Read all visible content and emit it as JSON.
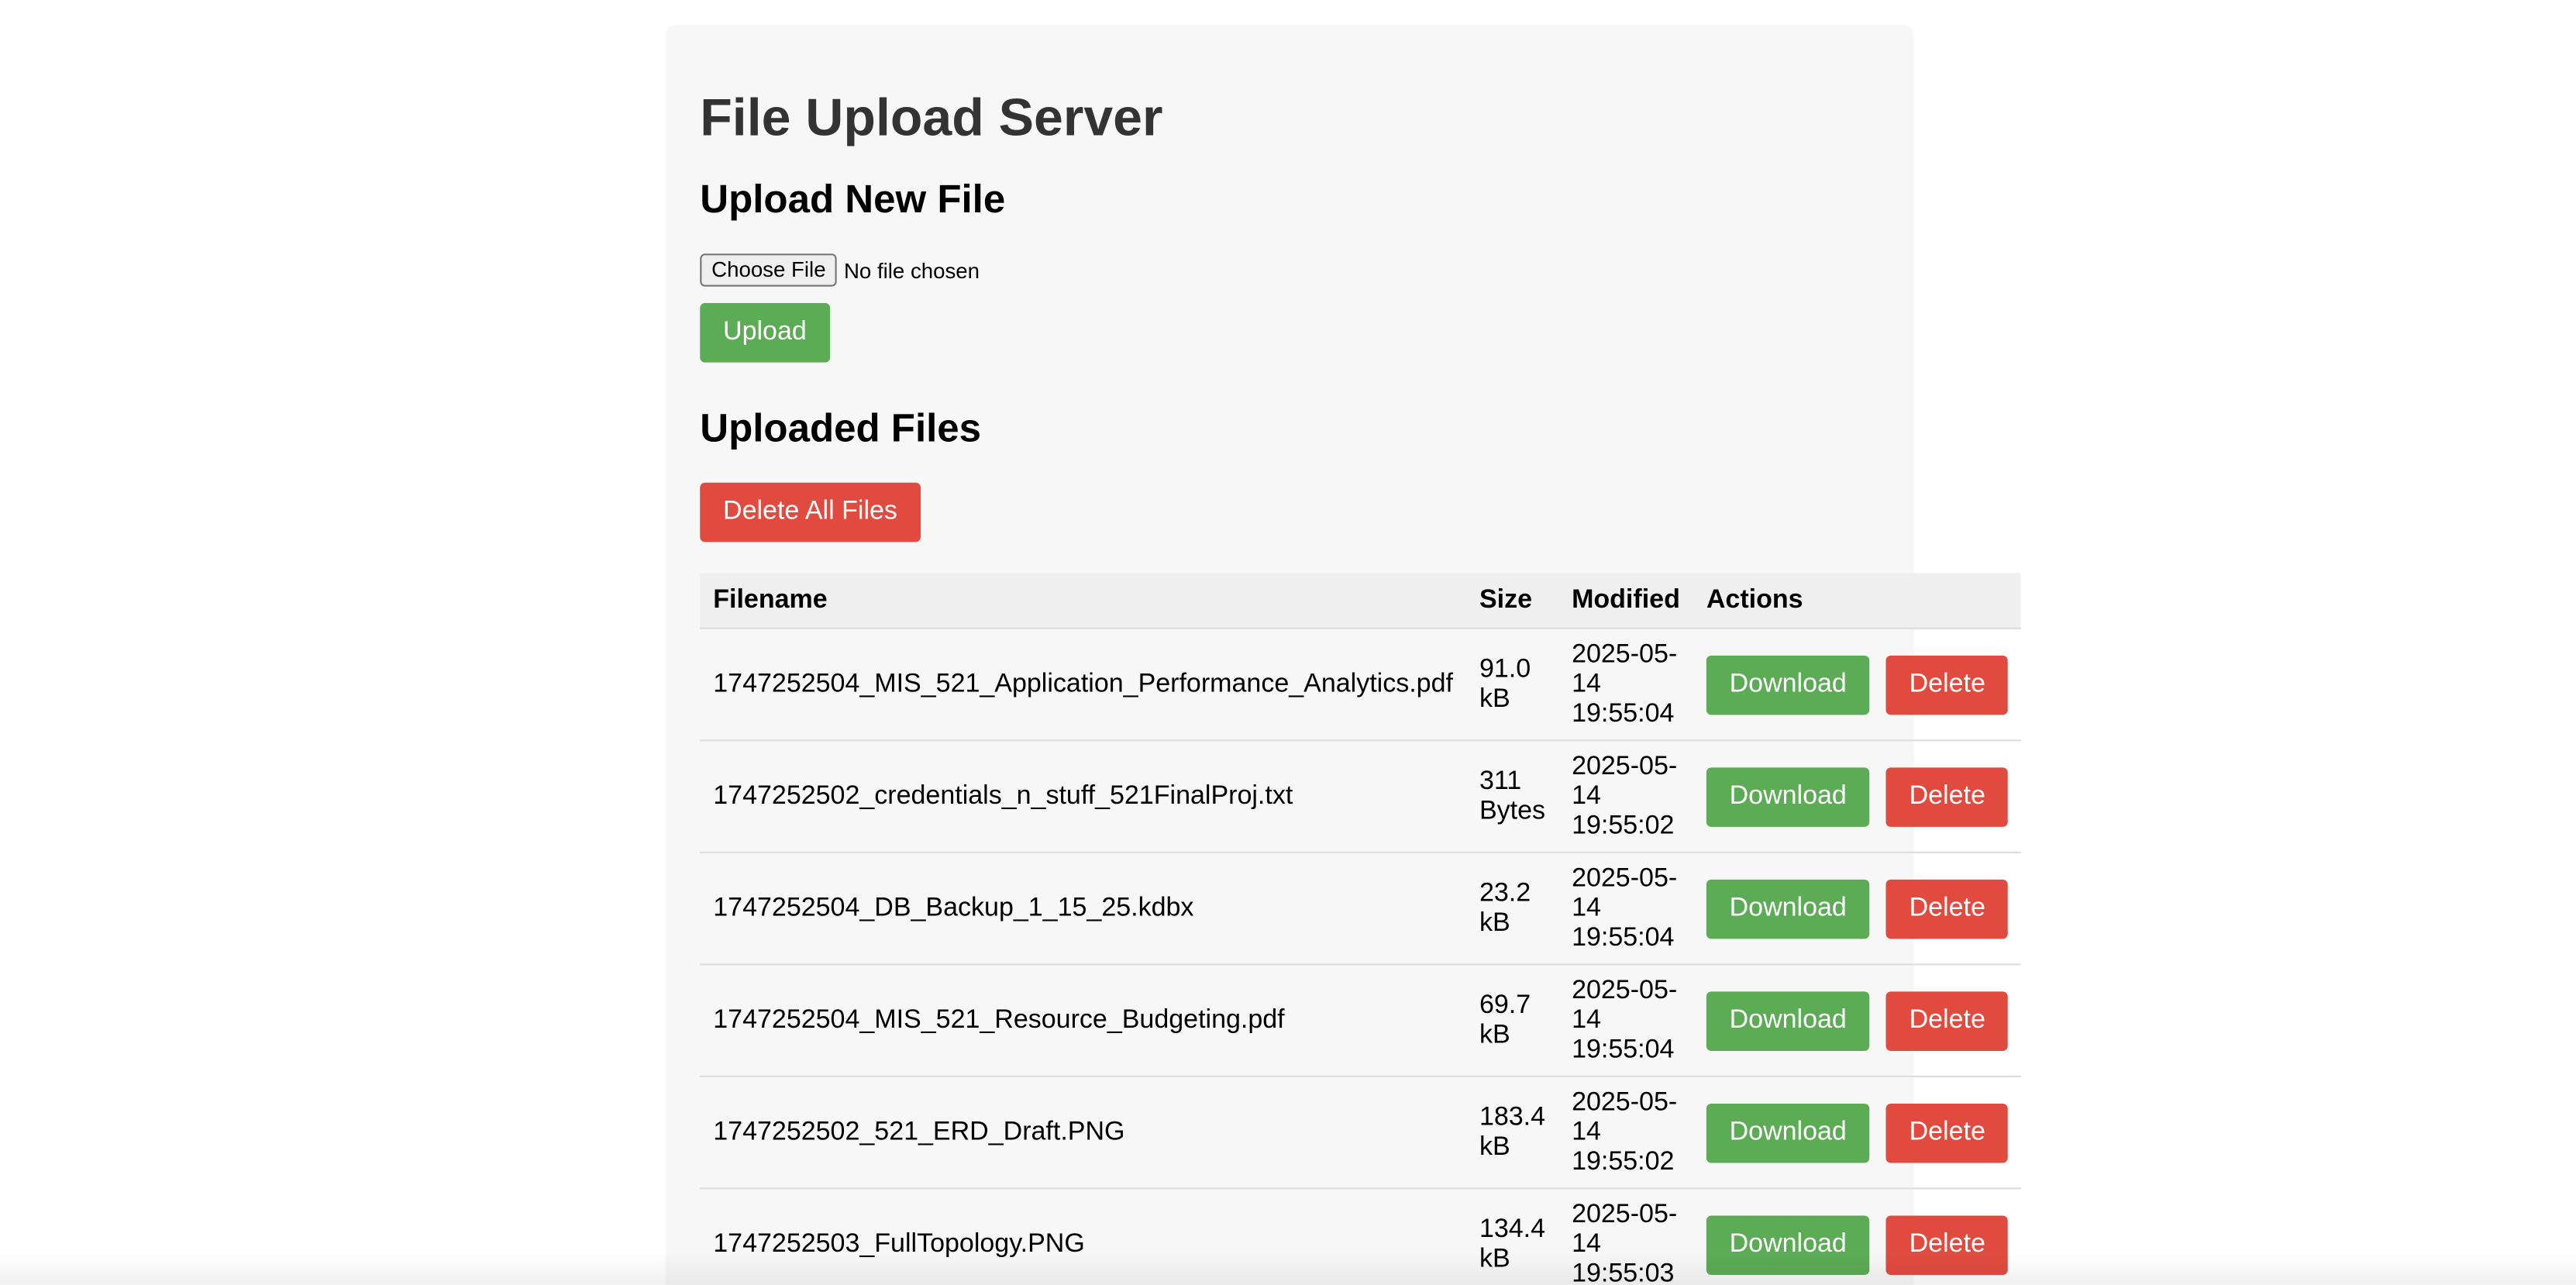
{
  "page": {
    "title": "File Upload Server"
  },
  "upload": {
    "heading": "Upload New File",
    "choose_label": "Choose File",
    "no_file_text": "No file chosen",
    "upload_label": "Upload"
  },
  "files": {
    "heading": "Uploaded Files",
    "delete_all_label": "Delete All Files",
    "columns": [
      "Filename",
      "Size",
      "Modified",
      "Actions"
    ],
    "download_label": "Download",
    "delete_label": "Delete",
    "rows": [
      {
        "filename": "1747252504_MIS_521_Application_Performance_Analytics.pdf",
        "size": "91.0 kB",
        "modified": "2025-05-14 19:55:04"
      },
      {
        "filename": "1747252502_credentials_n_stuff_521FinalProj.txt",
        "size": "311 Bytes",
        "modified": "2025-05-14 19:55:02"
      },
      {
        "filename": "1747252504_DB_Backup_1_15_25.kdbx",
        "size": "23.2 kB",
        "modified": "2025-05-14 19:55:04"
      },
      {
        "filename": "1747252504_MIS_521_Resource_Budgeting.pdf",
        "size": "69.7 kB",
        "modified": "2025-05-14 19:55:04"
      },
      {
        "filename": "1747252502_521_ERD_Draft.PNG",
        "size": "183.4 kB",
        "modified": "2025-05-14 19:55:02"
      },
      {
        "filename": "1747252503_FullTopology.PNG",
        "size": "134.4 kB",
        "modified": "2025-05-14 19:55:03"
      }
    ]
  },
  "colors": {
    "download": "#5cab55",
    "delete": "#e14b3f",
    "panel": "#f7f7f7"
  }
}
